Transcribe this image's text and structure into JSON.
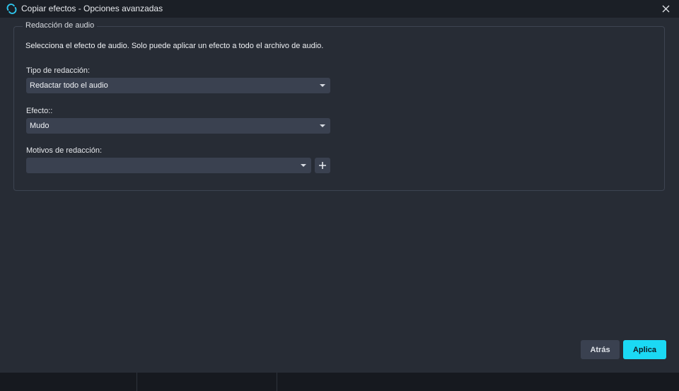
{
  "window": {
    "title": "Copiar efectos - Opciones avanzadas",
    "icon": "swap-cycle-icon",
    "close_icon": "close-icon"
  },
  "group": {
    "legend": "Redacción de audio",
    "hint": "Selecciona el efecto de audio. Solo puede aplicar un efecto a todo el archivo de audio."
  },
  "fields": {
    "redaction_type": {
      "label": "Tipo de redacción:",
      "value": "Redactar todo el audio"
    },
    "effect": {
      "label": "Efecto::",
      "value": "Mudo"
    },
    "reasons": {
      "label": "Motivos de redacción:",
      "value": ""
    }
  },
  "buttons": {
    "back": "Atrás",
    "apply": "Aplica"
  },
  "colors": {
    "accent": "#1bd9f4",
    "background": "#272c35",
    "control": "#3a4150"
  }
}
